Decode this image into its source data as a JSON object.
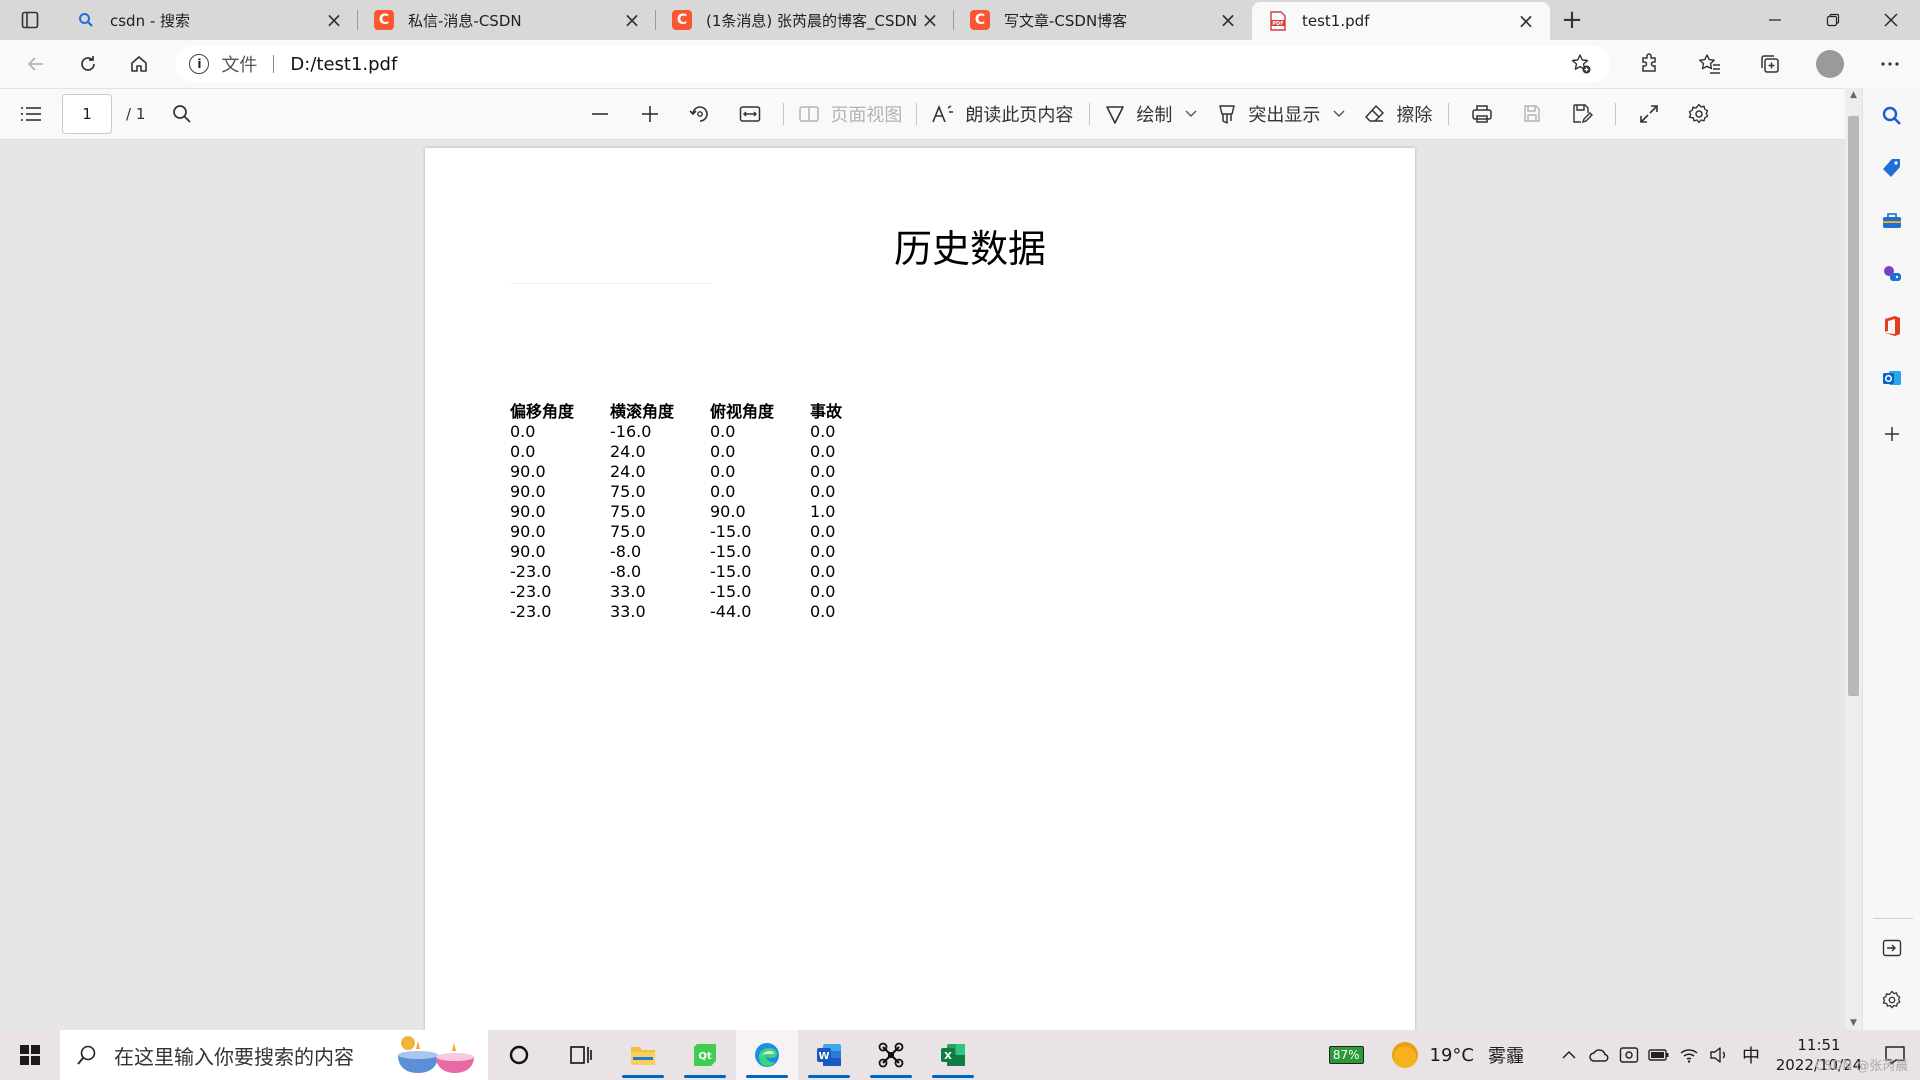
{
  "tabs": [
    {
      "title": "csdn - 搜索",
      "icon": "search-icon"
    },
    {
      "title": "私信-消息-CSDN",
      "icon": "csdn-icon"
    },
    {
      "title": "(1条消息) 张芮晨的博客_CSDN博",
      "icon": "csdn-icon"
    },
    {
      "title": "写文章-CSDN博客",
      "icon": "csdn-icon"
    },
    {
      "title": "test1.pdf",
      "icon": "pdf-icon",
      "active": true
    }
  ],
  "address": {
    "scheme_label": "文件",
    "url": "D:/test1.pdf"
  },
  "pdf_toolbar": {
    "page_current": "1",
    "page_total": "/ 1",
    "page_view_label": "页面视图",
    "read_aloud_label": "朗读此页内容",
    "draw_label": "绘制",
    "highlight_label": "突出显示",
    "erase_label": "擦除"
  },
  "document": {
    "title": "历史数据",
    "table": {
      "headers": [
        "偏移角度",
        "横滚角度",
        "俯视角度",
        "事故"
      ],
      "rows": [
        [
          "0.0",
          "-16.0",
          "0.0",
          "0.0"
        ],
        [
          "0.0",
          "24.0",
          "0.0",
          "0.0"
        ],
        [
          "90.0",
          "24.0",
          "0.0",
          "0.0"
        ],
        [
          "90.0",
          "75.0",
          "0.0",
          "0.0"
        ],
        [
          "90.0",
          "75.0",
          "90.0",
          "1.0"
        ],
        [
          "90.0",
          "75.0",
          "-15.0",
          "0.0"
        ],
        [
          "90.0",
          "-8.0",
          "-15.0",
          "0.0"
        ],
        [
          "-23.0",
          "-8.0",
          "-15.0",
          "0.0"
        ],
        [
          "-23.0",
          "33.0",
          "-15.0",
          "0.0"
        ],
        [
          "-23.0",
          "33.0",
          "-44.0",
          "0.0"
        ]
      ]
    }
  },
  "taskbar": {
    "search_placeholder": "在这里输入你要搜索的内容",
    "battery": "87%",
    "weather_temp": "19°C",
    "weather_desc": "雾霾",
    "ime": "中",
    "time": "11:51",
    "date": "2022/10/24"
  },
  "watermark": "CSDN @张芮晨",
  "colors": {
    "accent": "#0067c0",
    "csdn_red": "#fc5531",
    "pdf_red": "#d63b3b"
  }
}
